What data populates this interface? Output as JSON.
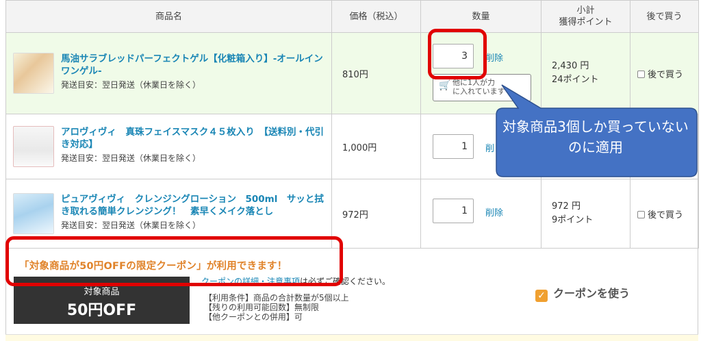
{
  "headers": {
    "name": "商品名",
    "price": "価格（税込）",
    "qty": "数量",
    "subtotal_l1": "小計",
    "subtotal_l2": "獲得ポイント",
    "later": "後で買う"
  },
  "items": [
    {
      "name": "馬油サラブレッドパーフェクトゲル【化粧箱入り】-オールインワンゲル-",
      "ship": "発送目安：翌日発送（休業日を除く）",
      "price": "810円",
      "qty": "3",
      "delete": "削除",
      "others": "他に1人が力",
      "others2": "に入れています",
      "subtotal": "2,430 円",
      "points": "24ポイント",
      "later": "後で買う"
    },
    {
      "name": "アロヴィヴィ　真珠フェイスマスク４５枚入り　【送料別・代引き対応】",
      "ship": "発送目安：翌日発送（休業日を除く）",
      "price": "1,000円",
      "qty": "1",
      "delete": "削"
    },
    {
      "name": "ピュアヴィヴィ　クレンジングローション　500ml　サッと拭き取れる簡単クレンジング！　素早くメイク落とし",
      "ship": "発送目安：翌日発送（休業日を除く）",
      "price": "972円",
      "qty": "1",
      "delete": "削除",
      "subtotal": "972 円",
      "points": "9ポイント",
      "later": "後で買う"
    }
  ],
  "coupon": {
    "message": "「対象商品が50円OFFの限定クーポン」が利用できます！",
    "badge_top": "対象商品",
    "badge_value": "50円OFF",
    "detail_link": "クーポンの詳細・注意事項",
    "detail_rest": "は必ずご確認ください。",
    "cond1": "【利用条件】商品の合計数量が5個以上",
    "cond2": "【残りの利用可能回数】無制限",
    "cond3": "【他クーポンとの併用】可",
    "use_label": "クーポンを使う"
  },
  "callout": {
    "text": "対象商品3個しか買っていないのに適用"
  },
  "colors": {
    "link": "#1a86b5",
    "coupon_msg": "#e0832a",
    "annotation_red": "#e10000",
    "callout_fill": "#4472c4",
    "row_highlight": "#f0fbe8"
  }
}
